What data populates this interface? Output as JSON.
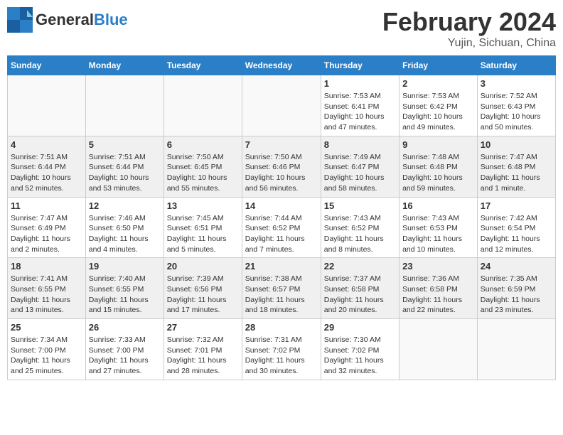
{
  "header": {
    "logo_general": "General",
    "logo_blue": "Blue",
    "month_title": "February 2024",
    "location": "Yujin, Sichuan, China"
  },
  "weekdays": [
    "Sunday",
    "Monday",
    "Tuesday",
    "Wednesday",
    "Thursday",
    "Friday",
    "Saturday"
  ],
  "weeks": [
    {
      "shade": "white",
      "days": [
        {
          "num": "",
          "info": ""
        },
        {
          "num": "",
          "info": ""
        },
        {
          "num": "",
          "info": ""
        },
        {
          "num": "",
          "info": ""
        },
        {
          "num": "1",
          "info": "Sunrise: 7:53 AM\nSunset: 6:41 PM\nDaylight: 10 hours\nand 47 minutes."
        },
        {
          "num": "2",
          "info": "Sunrise: 7:53 AM\nSunset: 6:42 PM\nDaylight: 10 hours\nand 49 minutes."
        },
        {
          "num": "3",
          "info": "Sunrise: 7:52 AM\nSunset: 6:43 PM\nDaylight: 10 hours\nand 50 minutes."
        }
      ]
    },
    {
      "shade": "shaded",
      "days": [
        {
          "num": "4",
          "info": "Sunrise: 7:51 AM\nSunset: 6:44 PM\nDaylight: 10 hours\nand 52 minutes."
        },
        {
          "num": "5",
          "info": "Sunrise: 7:51 AM\nSunset: 6:44 PM\nDaylight: 10 hours\nand 53 minutes."
        },
        {
          "num": "6",
          "info": "Sunrise: 7:50 AM\nSunset: 6:45 PM\nDaylight: 10 hours\nand 55 minutes."
        },
        {
          "num": "7",
          "info": "Sunrise: 7:50 AM\nSunset: 6:46 PM\nDaylight: 10 hours\nand 56 minutes."
        },
        {
          "num": "8",
          "info": "Sunrise: 7:49 AM\nSunset: 6:47 PM\nDaylight: 10 hours\nand 58 minutes."
        },
        {
          "num": "9",
          "info": "Sunrise: 7:48 AM\nSunset: 6:48 PM\nDaylight: 10 hours\nand 59 minutes."
        },
        {
          "num": "10",
          "info": "Sunrise: 7:47 AM\nSunset: 6:48 PM\nDaylight: 11 hours\nand 1 minute."
        }
      ]
    },
    {
      "shade": "white",
      "days": [
        {
          "num": "11",
          "info": "Sunrise: 7:47 AM\nSunset: 6:49 PM\nDaylight: 11 hours\nand 2 minutes."
        },
        {
          "num": "12",
          "info": "Sunrise: 7:46 AM\nSunset: 6:50 PM\nDaylight: 11 hours\nand 4 minutes."
        },
        {
          "num": "13",
          "info": "Sunrise: 7:45 AM\nSunset: 6:51 PM\nDaylight: 11 hours\nand 5 minutes."
        },
        {
          "num": "14",
          "info": "Sunrise: 7:44 AM\nSunset: 6:52 PM\nDaylight: 11 hours\nand 7 minutes."
        },
        {
          "num": "15",
          "info": "Sunrise: 7:43 AM\nSunset: 6:52 PM\nDaylight: 11 hours\nand 8 minutes."
        },
        {
          "num": "16",
          "info": "Sunrise: 7:43 AM\nSunset: 6:53 PM\nDaylight: 11 hours\nand 10 minutes."
        },
        {
          "num": "17",
          "info": "Sunrise: 7:42 AM\nSunset: 6:54 PM\nDaylight: 11 hours\nand 12 minutes."
        }
      ]
    },
    {
      "shade": "shaded",
      "days": [
        {
          "num": "18",
          "info": "Sunrise: 7:41 AM\nSunset: 6:55 PM\nDaylight: 11 hours\nand 13 minutes."
        },
        {
          "num": "19",
          "info": "Sunrise: 7:40 AM\nSunset: 6:55 PM\nDaylight: 11 hours\nand 15 minutes."
        },
        {
          "num": "20",
          "info": "Sunrise: 7:39 AM\nSunset: 6:56 PM\nDaylight: 11 hours\nand 17 minutes."
        },
        {
          "num": "21",
          "info": "Sunrise: 7:38 AM\nSunset: 6:57 PM\nDaylight: 11 hours\nand 18 minutes."
        },
        {
          "num": "22",
          "info": "Sunrise: 7:37 AM\nSunset: 6:58 PM\nDaylight: 11 hours\nand 20 minutes."
        },
        {
          "num": "23",
          "info": "Sunrise: 7:36 AM\nSunset: 6:58 PM\nDaylight: 11 hours\nand 22 minutes."
        },
        {
          "num": "24",
          "info": "Sunrise: 7:35 AM\nSunset: 6:59 PM\nDaylight: 11 hours\nand 23 minutes."
        }
      ]
    },
    {
      "shade": "white",
      "days": [
        {
          "num": "25",
          "info": "Sunrise: 7:34 AM\nSunset: 7:00 PM\nDaylight: 11 hours\nand 25 minutes."
        },
        {
          "num": "26",
          "info": "Sunrise: 7:33 AM\nSunset: 7:00 PM\nDaylight: 11 hours\nand 27 minutes."
        },
        {
          "num": "27",
          "info": "Sunrise: 7:32 AM\nSunset: 7:01 PM\nDaylight: 11 hours\nand 28 minutes."
        },
        {
          "num": "28",
          "info": "Sunrise: 7:31 AM\nSunset: 7:02 PM\nDaylight: 11 hours\nand 30 minutes."
        },
        {
          "num": "29",
          "info": "Sunrise: 7:30 AM\nSunset: 7:02 PM\nDaylight: 11 hours\nand 32 minutes."
        },
        {
          "num": "",
          "info": ""
        },
        {
          "num": "",
          "info": ""
        }
      ]
    }
  ]
}
